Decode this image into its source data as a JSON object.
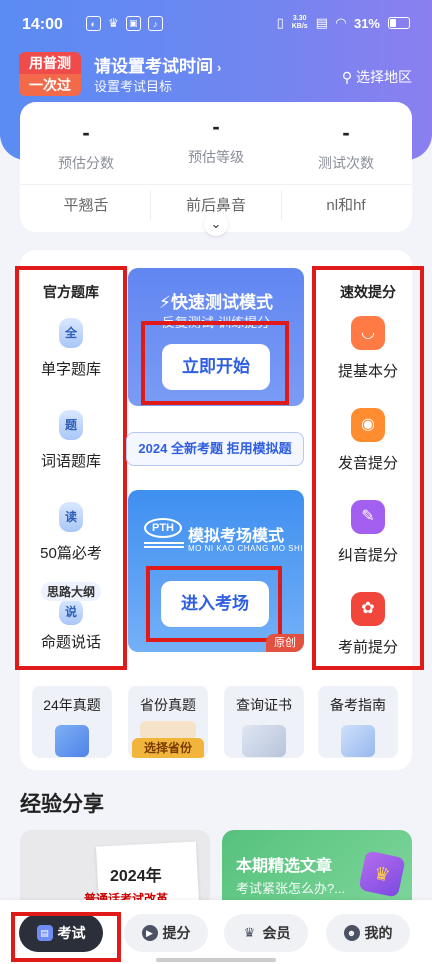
{
  "status_bar": {
    "time": "14:00",
    "net_speed_top": "3.30",
    "net_speed_bottom": "KB/s",
    "battery": "31%"
  },
  "header": {
    "logo_top": "用普测",
    "logo_bottom": "一次过",
    "title": "请设置考试时间",
    "subtitle": "设置考试目标",
    "region_label": "选择地区"
  },
  "stats": [
    {
      "value": "-",
      "label": "预估分数"
    },
    {
      "value": "-",
      "label": "预估等级"
    },
    {
      "value": "-",
      "label": "测试次数"
    }
  ],
  "tags": [
    "平翘舌",
    "前后鼻音",
    "nl和hf"
  ],
  "question_bank": {
    "heading": "官方题库",
    "items": [
      {
        "icon_char": "全",
        "label": "单字题库"
      },
      {
        "icon_char": "题",
        "label": "词语题库"
      },
      {
        "icon_char": "读",
        "label": "50篇必考"
      },
      {
        "icon_char": "说",
        "badge": "思路大纲",
        "label": "命题说话"
      }
    ]
  },
  "quick_mode": {
    "title": "快速测试模式",
    "subtitle": "反复测试·训练提分",
    "button": "立即开始"
  },
  "banner": "2024 全新考题 拒用模拟题",
  "mock_mode": {
    "logo": "PTH",
    "title": "模拟考场模式",
    "subtitle": "MO NI KAO CHANG MO SHI",
    "button": "进入考场",
    "corner_tag": "原创"
  },
  "improve": {
    "heading": "速效提分",
    "items": [
      {
        "label": "提基本分",
        "color": "#ff7a45"
      },
      {
        "label": "发音提分",
        "color": "#ff8c2e"
      },
      {
        "label": "纠音提分",
        "color": "#a35ff0"
      },
      {
        "label": "考前提分",
        "color": "#f0463c"
      }
    ]
  },
  "tools": [
    {
      "label": "24年真题",
      "tag": ""
    },
    {
      "label": "省份真题",
      "tag": "选择省份"
    },
    {
      "label": "查询证书",
      "tag": ""
    },
    {
      "label": "备考指南",
      "tag": ""
    }
  ],
  "experience": {
    "title": "经验分享",
    "card_a": {
      "year": "2024年",
      "text": "普通话考试改革"
    },
    "card_b": {
      "title": "本期精选文章",
      "subtitle": "考试紧张怎么办?..."
    }
  },
  "nav": [
    {
      "label": "考试",
      "icon": "exam-icon"
    },
    {
      "label": "提分",
      "icon": "play-icon"
    },
    {
      "label": "会员",
      "icon": "crown-icon"
    },
    {
      "label": "我的",
      "icon": "profile-icon"
    }
  ]
}
